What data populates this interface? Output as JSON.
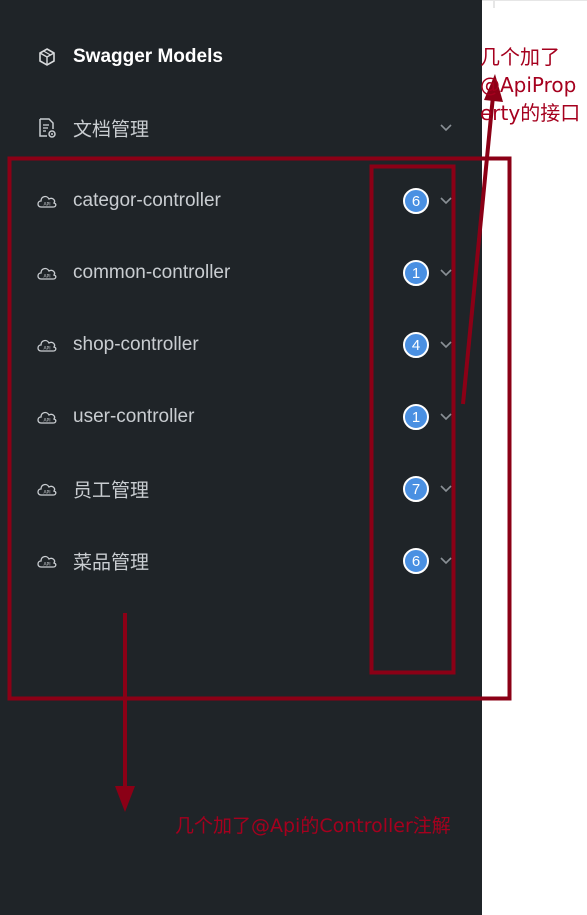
{
  "sidebar": {
    "header": {
      "label": "Swagger Models",
      "icon": "cube-icon"
    },
    "doc_manage": {
      "label": "文档管理",
      "icon": "doc-settings-icon"
    },
    "items": [
      {
        "label": "categor-controller",
        "count": "6",
        "icon": "api-cloud-icon"
      },
      {
        "label": "common-controller",
        "count": "1",
        "icon": "api-cloud-icon"
      },
      {
        "label": "shop-controller",
        "count": "4",
        "icon": "api-cloud-icon"
      },
      {
        "label": "user-controller",
        "count": "1",
        "icon": "api-cloud-icon"
      },
      {
        "label": "员工管理",
        "count": "7",
        "icon": "api-cloud-icon"
      },
      {
        "label": "菜品管理",
        "count": "6",
        "icon": "api-cloud-icon"
      }
    ]
  },
  "annotations": {
    "right_note_lines": [
      "几个加了",
      "@ApiProp",
      "erty的接口"
    ],
    "bottom_note": "几个加了@Api的Controller注解",
    "color": "#a5001e"
  },
  "colors": {
    "sidebar_bg": "#1f2428",
    "badge": "#4a90e2"
  }
}
